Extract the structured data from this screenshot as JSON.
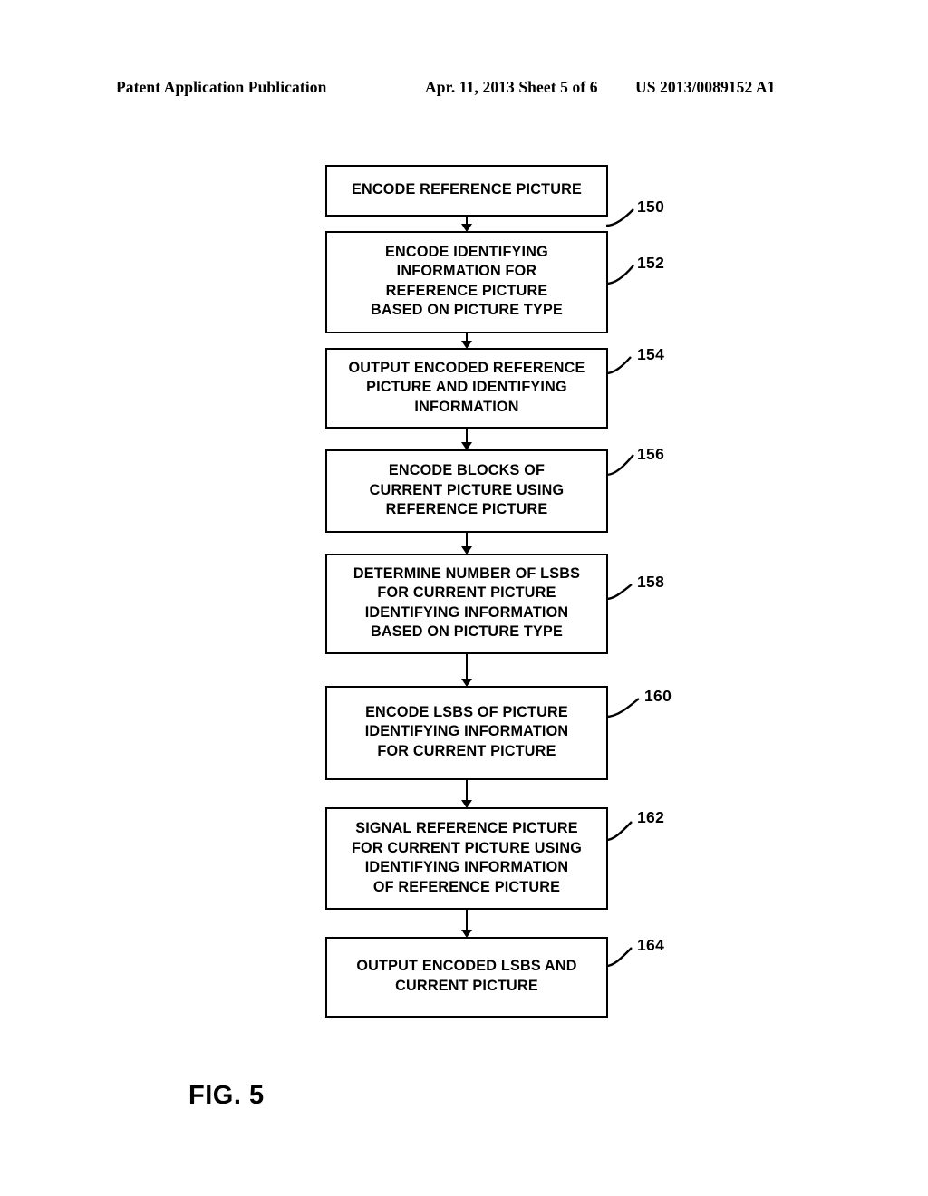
{
  "header": {
    "left": "Patent Application Publication",
    "middle": "Apr. 11, 2013  Sheet 5 of 6",
    "right": "US 2013/0089152 A1"
  },
  "figure": {
    "caption": "FIG. 5",
    "nodes": [
      {
        "ref": "150",
        "lines": [
          "ENCODE REFERENCE PICTURE"
        ]
      },
      {
        "ref": "152",
        "lines": [
          "ENCODE IDENTIFYING",
          "INFORMATION FOR",
          "REFERENCE PICTURE",
          "BASED ON PICTURE TYPE"
        ]
      },
      {
        "ref": "154",
        "lines": [
          "OUTPUT ENCODED REFERENCE",
          "PICTURE AND IDENTIFYING",
          "INFORMATION"
        ]
      },
      {
        "ref": "156",
        "lines": [
          "ENCODE BLOCKS OF",
          "CURRENT PICTURE USING",
          "REFERENCE PICTURE"
        ]
      },
      {
        "ref": "158",
        "lines": [
          "DETERMINE NUMBER OF LSBS",
          "FOR CURRENT PICTURE",
          "IDENTIFYING INFORMATION",
          "BASED ON PICTURE TYPE"
        ]
      },
      {
        "ref": "160",
        "lines": [
          "ENCODE LSBS OF PICTURE",
          "IDENTIFYING INFORMATION",
          "FOR CURRENT PICTURE"
        ]
      },
      {
        "ref": "162",
        "lines": [
          "SIGNAL REFERENCE PICTURE",
          "FOR CURRENT PICTURE USING",
          "IDENTIFYING INFORMATION",
          "OF REFERENCE PICTURE"
        ]
      },
      {
        "ref": "164",
        "lines": [
          "OUTPUT ENCODED LSBS AND",
          "CURRENT PICTURE"
        ]
      }
    ]
  },
  "colors": {
    "ink": "#000000",
    "paper": "#ffffff"
  }
}
